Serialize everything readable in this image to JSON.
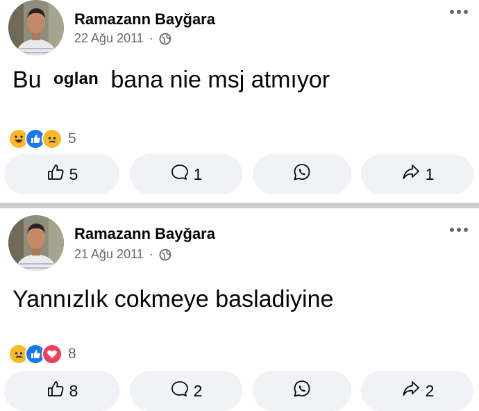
{
  "posts": [
    {
      "author": "Ramazann Bayğara",
      "date": "22 Ağu 2011",
      "separator": "·",
      "text_before": "Bu",
      "text_sticker": "oglan",
      "text_after": "bana nie msj atmıyor",
      "reactions": [
        "haha",
        "like",
        "sad"
      ],
      "reaction_count": "5",
      "like_count": "5",
      "comment_count": "1",
      "share_count": "1"
    },
    {
      "author": "Ramazann Bayğara",
      "date": "21 Ağu 2011",
      "separator": "·",
      "text": "Yannızlık cokmeye basladiyine",
      "reactions": [
        "sad",
        "like",
        "love"
      ],
      "reaction_count": "8",
      "like_count": "8",
      "comment_count": "2",
      "share_count": "2"
    }
  ],
  "colors": {
    "like": "#1877f2",
    "love": "#f33e58",
    "yellow": "#f7b928",
    "button_bg": "#f0f2f5",
    "secondary_text": "#65676b"
  },
  "icons": [
    "globe-icon",
    "more-icon",
    "like-icon",
    "comment-icon",
    "whatsapp-icon",
    "share-icon",
    "haha-reaction-icon",
    "like-reaction-icon",
    "sad-reaction-icon",
    "love-reaction-icon"
  ]
}
